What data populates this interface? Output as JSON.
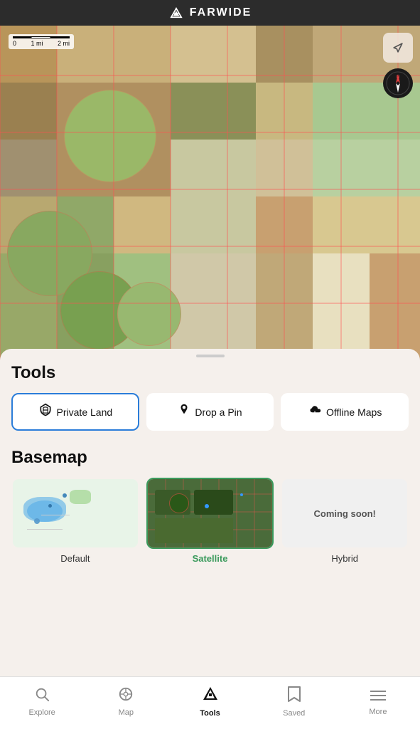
{
  "header": {
    "title": "FARWIDE",
    "logo_alt": "farwide-logo"
  },
  "map": {
    "scale": {
      "label_start": "0",
      "label_mid": "1 mi",
      "label_end": "2 mi"
    },
    "location_btn_icon": "↗",
    "compass_label": "N"
  },
  "tools_section": {
    "title": "Tools",
    "buttons": [
      {
        "id": "private-land",
        "label": "Private Land",
        "icon": "🏔",
        "active": true
      },
      {
        "id": "drop-pin",
        "label": "Drop a Pin",
        "icon": "📍",
        "active": false
      },
      {
        "id": "offline-maps",
        "label": "Offline Maps",
        "icon": "☁",
        "active": false
      }
    ]
  },
  "basemap_section": {
    "title": "Basemap",
    "items": [
      {
        "id": "default",
        "label": "Default",
        "selected": false
      },
      {
        "id": "satellite",
        "label": "Satellite",
        "selected": true
      },
      {
        "id": "hybrid",
        "label": "Hybrid",
        "coming_soon": true,
        "coming_soon_text": "Coming soon!"
      }
    ]
  },
  "nav": {
    "items": [
      {
        "id": "explore",
        "label": "Explore",
        "icon": "🔍",
        "active": false
      },
      {
        "id": "map",
        "label": "Map",
        "icon": "🧭",
        "active": false
      },
      {
        "id": "tools",
        "label": "Tools",
        "icon": "◆",
        "active": true
      },
      {
        "id": "saved",
        "label": "Saved",
        "icon": "🔖",
        "active": false
      },
      {
        "id": "more",
        "label": "More",
        "icon": "≡",
        "active": false
      }
    ]
  }
}
